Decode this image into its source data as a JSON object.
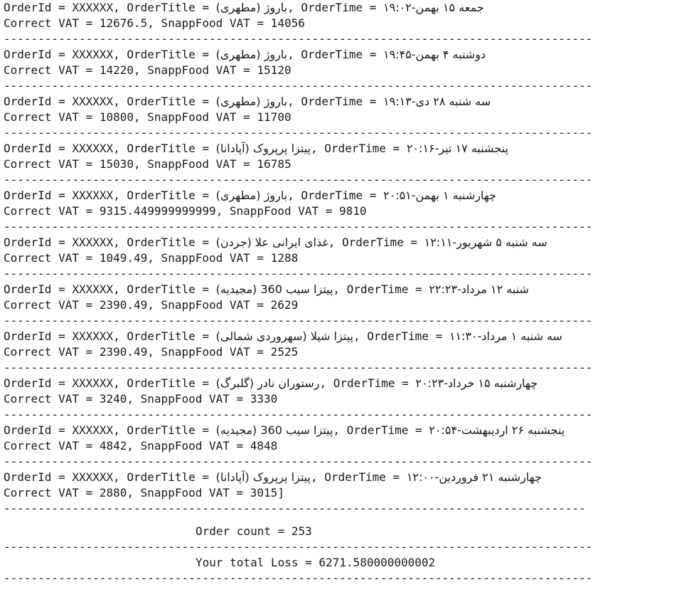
{
  "orders": [
    {
      "line1_prefix": "OrderId = XXXXXX, OrderTitle = ",
      "title": "باروژ (مطهری)",
      "line1_mid": ", OrderTime = ",
      "time": "جمعه ۱۵ بهمن-۱۹:۰۲",
      "line2": "Correct VAT = 12676.5, SnappFood VAT = 14056"
    },
    {
      "line1_prefix": "OrderId = XXXXXX, OrderTitle = ",
      "title": "باروژ (مطهری)",
      "line1_mid": ", OrderTime = ",
      "time": "دوشنبه ۴ بهمن-۱۹:۴۵",
      "line2": "Correct VAT = 14220, SnappFood VAT = 15120"
    },
    {
      "line1_prefix": "OrderId = XXXXXX, OrderTitle = ",
      "title": "باروژ (مطهری)",
      "line1_mid": ", OrderTime = ",
      "time": "سه شنبه ۲۸ دی-۱۹:۱۳",
      "line2": "Correct VAT = 10800, SnappFood VAT = 11700"
    },
    {
      "line1_prefix": "OrderId = XXXXXX, OrderTitle = ",
      "title": "پیتزا پرپروک (آپادانا)",
      "line1_mid": ", OrderTime = ",
      "time": "پنجشنبه ۱۷ تیر-۲۰:۱۶",
      "line2": "Correct VAT = 15030, SnappFood VAT = 16785"
    },
    {
      "line1_prefix": "OrderId = XXXXXX, OrderTitle = ",
      "title": "باروژ (مطهری)",
      "line1_mid": ", OrderTime = ",
      "time": "چهارشنبه ۱ بهمن-۲۰:۵۱",
      "line2": "Correct VAT = 9315.449999999999, SnappFood VAT = 9810"
    },
    {
      "line1_prefix": "OrderId = XXXXXX, OrderTitle = ",
      "title": "غذای ایرانی علا (جردن)",
      "line1_mid": ", OrderTime = ",
      "time": "سه شنبه ۵ شهریور-۱۲:۱۱",
      "line2": "Correct VAT = 1049.49, SnappFood VAT = 1288"
    },
    {
      "line1_prefix": "OrderId = XXXXXX, OrderTitle = ",
      "title": "پیتزا سیب 360 (مجیدیه)",
      "line1_mid": ", OrderTime = ",
      "time": "شنبه ۱۲ مرداد-۲۲:۲۳",
      "line2": "Correct VAT = 2390.49, SnappFood VAT = 2629"
    },
    {
      "line1_prefix": "OrderId = XXXXXX, OrderTitle = ",
      "title": "پیتزا شیلا (سهروردی شمالی)",
      "line1_mid": ", OrderTime = ",
      "time": "سه شنبه ۱ مرداد-۱۱:۳۰",
      "line2": "Correct VAT = 2390.49, SnappFood VAT = 2525"
    },
    {
      "line1_prefix": "OrderId = XXXXXX, OrderTitle = ",
      "title": "رستوران نادر (گلبرگ)",
      "line1_mid": ", OrderTime = ",
      "time": "چهارشنبه ۱۵ خرداد-۲۰:۲۳",
      "line2": "Correct VAT = 3240, SnappFood VAT = 3330"
    },
    {
      "line1_prefix": "OrderId = XXXXXX, OrderTitle = ",
      "title": "پیتزا سیب 360 (مجیدیه)",
      "line1_mid": ", OrderTime = ",
      "time": "پنجشنبه ۲۶ اردیبهشت-۲۰:۵۴",
      "line2": "Correct VAT = 4842, SnappFood VAT = 4848"
    },
    {
      "line1_prefix": "OrderId = XXXXXX, OrderTitle = ",
      "title": "پیتزا پرپروک (آپادانا)",
      "line1_mid": ", OrderTime = ",
      "time": "چهارشنبه ۲۱ فروردین-۱۲:۰۰",
      "line2": "Correct VAT = 2880, SnappFood VAT = 3015]"
    }
  ],
  "separator": "--------------------------------------------------------------------------------------",
  "separator_short": "-------------------------------------------------------------------------------------",
  "summary": {
    "order_count_line": "Order count = 253",
    "total_loss_line": "Your total Loss = 6271.580000000002"
  }
}
